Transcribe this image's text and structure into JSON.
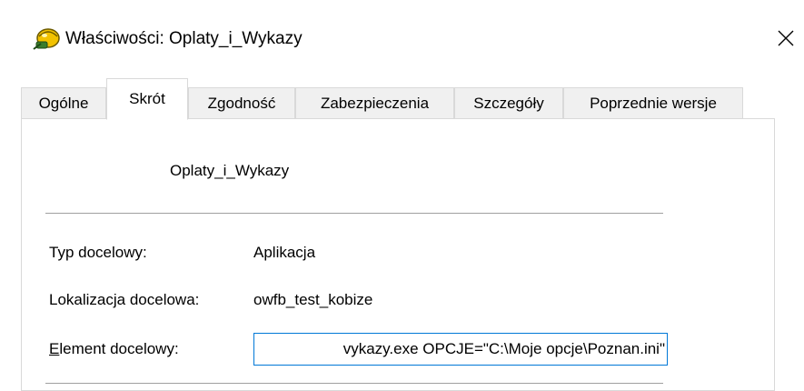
{
  "window": {
    "title": "Właściwości: Oplaty_i_Wykazy",
    "close_symbol": "✕"
  },
  "tabs": [
    {
      "label": "Ogólne",
      "active": false
    },
    {
      "label": "Skrót",
      "active": true
    },
    {
      "label": "Zgodność",
      "active": false
    },
    {
      "label": "Zabezpieczenia",
      "active": false
    },
    {
      "label": "Szczegóły",
      "active": false
    },
    {
      "label": "Poprzednie wersje",
      "active": false
    }
  ],
  "shortcut": {
    "name": "Oplaty_i_Wykazy",
    "target_type_label": "Typ docelowy:",
    "target_type_value": "Aplikacja",
    "target_location_label": "Lokalizacja docelowa:",
    "target_location_value": "owfb_test_kobize",
    "target_label_rest": "lement docelowy:",
    "target_label_mnemonic": "E",
    "target_value": "vykazy.exe OPCJE=\"C:\\Moje opcje\\Poznan.ini\""
  },
  "colors": {
    "focus_border": "#0078d7",
    "tab_inactive_bg": "#f0f0f0",
    "border": "#d9d9d9"
  }
}
